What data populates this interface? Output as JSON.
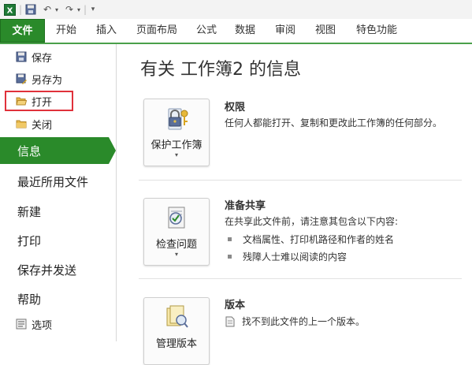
{
  "quick_access": {
    "icons": [
      "excel-icon",
      "save-icon",
      "undo-icon",
      "redo-icon",
      "customize-icon"
    ]
  },
  "ribbon": {
    "tabs": [
      "文件",
      "开始",
      "插入",
      "页面布局",
      "公式",
      "数据",
      "审阅",
      "视图",
      "特色功能"
    ],
    "accent_color": "#2a8a2a"
  },
  "backstage_nav": {
    "small_items": [
      {
        "label": "保存",
        "icon": "save-icon"
      },
      {
        "label": "另存为",
        "icon": "save-as-icon"
      },
      {
        "label": "打开",
        "icon": "open-folder-icon",
        "highlighted": true
      },
      {
        "label": "关闭",
        "icon": "close-folder-icon"
      }
    ],
    "big_items": [
      "信息",
      "最近所用文件",
      "新建",
      "打印",
      "保存并发送",
      "帮助"
    ],
    "active": "信息",
    "options": {
      "label": "选项",
      "icon": "options-icon"
    }
  },
  "main": {
    "title": "有关 工作簿2 的信息",
    "sections": [
      {
        "button": "保护工作簿",
        "icon": "lock-key-icon",
        "title": "权限",
        "text": "任何人都能打开、复制和更改此工作簿的任何部分。"
      },
      {
        "button": "检查问题",
        "icon": "inspect-doc-icon",
        "title": "准备共享",
        "text": "在共享此文件前，请注意其包含以下内容:",
        "bullets": [
          "文档属性、打印机路径和作者的姓名",
          "残障人士难以阅读的内容"
        ]
      },
      {
        "button": "管理版本",
        "icon": "versions-icon",
        "title": "版本",
        "text": "找不到此文件的上一个版本。"
      }
    ]
  }
}
